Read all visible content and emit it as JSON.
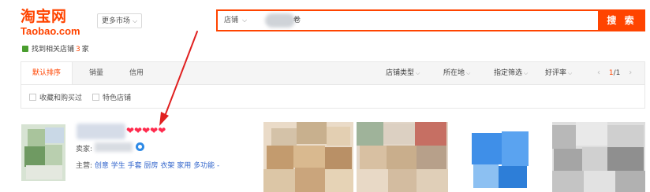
{
  "header": {
    "logo_cn": "淘宝网",
    "logo_en": "Taobao.com",
    "market_label": "更多市场"
  },
  "search": {
    "scope_label": "店铺",
    "query_suffix": "卷",
    "button_label": "搜 索"
  },
  "result_summary": {
    "prefix": "找到相关店铺",
    "count": "3",
    "suffix": "家"
  },
  "sort_tabs": [
    {
      "label": "默认排序",
      "active": true
    },
    {
      "label": "销量",
      "active": false
    },
    {
      "label": "信用",
      "active": false
    }
  ],
  "filters": [
    "店铺类型",
    "所在地",
    "指定筛选",
    "好评率"
  ],
  "pager": {
    "current": "1",
    "total": "1",
    "separator": "/"
  },
  "checkboxes": [
    "收藏和购买过",
    "特色店铺"
  ],
  "shop": {
    "rating_hearts": "❤❤❤❤❤",
    "seller_label": "卖家:",
    "main_label": "主营:",
    "main_keywords": "创意 学生 手套 厨房 衣架 家用 多功能 -"
  },
  "colors": {
    "brand": "#ff4400",
    "link": "#3366cc",
    "heart": "#ff2a4d",
    "annotation_arrow": "#e02020"
  }
}
